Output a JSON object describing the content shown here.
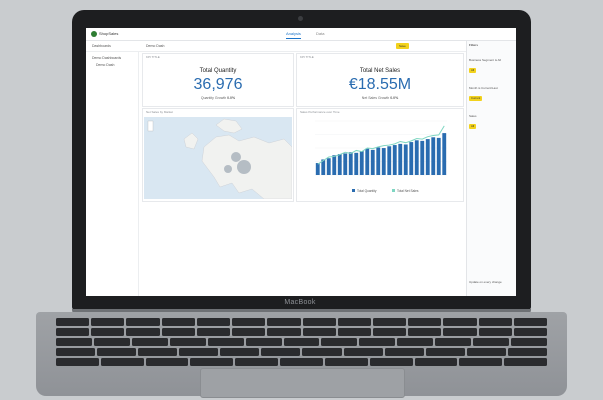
{
  "app": {
    "name": "ShopSales",
    "tabs": [
      "Analysis",
      "Data"
    ],
    "active_tab": "Analysis"
  },
  "toolbar": {
    "dashboard_label": "Dashboards",
    "current_dashboard": "Demo Dash",
    "save_button": "Save"
  },
  "sidebar": {
    "items": [
      "Demo Dashboards",
      "Demo Dash"
    ]
  },
  "kpis": [
    {
      "header": "KPI TITLE",
      "title": "Total Quantity",
      "value": "36,976",
      "sub_label": "Quantity Growth",
      "sub_value": "0.0%"
    },
    {
      "header": "KPI TITLE",
      "title": "Total Net Sales",
      "value": "€18.55M",
      "sub_label": "Net Sales Growth",
      "sub_value": "0.0%"
    }
  ],
  "map_panel": {
    "header": "Net Sales by Market"
  },
  "chart_panel": {
    "header": "Sales Performance over Time"
  },
  "chart_data": {
    "type": "bar",
    "title": "Sales Performance over Time",
    "series": [
      {
        "name": "Total Quantity",
        "values": [
          20,
          26,
          28,
          33,
          35,
          36,
          38,
          37,
          40,
          44,
          42,
          46,
          45,
          48,
          50,
          52,
          51,
          55,
          58,
          57,
          60,
          63,
          62,
          70
        ]
      },
      {
        "name": "Total Net Sales",
        "values": [
          18,
          24,
          30,
          31,
          34,
          38,
          36,
          41,
          39,
          45,
          44,
          47,
          49,
          50,
          52,
          56,
          54,
          57,
          61,
          60,
          64,
          66,
          67,
          82
        ]
      }
    ],
    "colors": {
      "bars": "#2a6cb0",
      "line": "#7fd6c2"
    }
  },
  "filters": {
    "title": "Filters",
    "groups": [
      {
        "label": "Business Segment is All",
        "value": "All"
      },
      {
        "label": "Month is Current/Last",
        "value": "Current"
      },
      {
        "label": "Sales",
        "value": "All"
      }
    ],
    "footer": "Update on every change"
  },
  "laptop_brand": "MacBook"
}
